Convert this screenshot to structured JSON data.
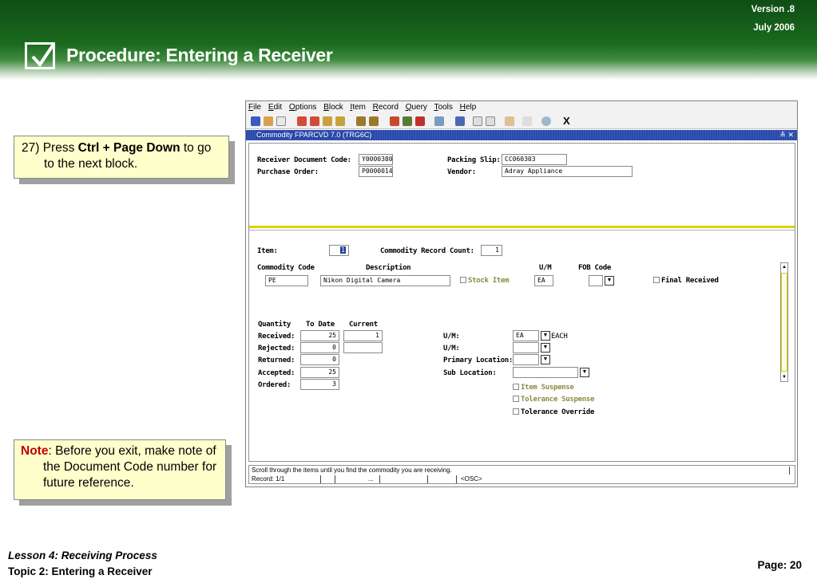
{
  "header": {
    "version": "Version .8",
    "date": "July  2006",
    "title": "Procedure: Entering a Receiver"
  },
  "callouts": {
    "step": {
      "number": "27)",
      "pre": " Press ",
      "keys": "Ctrl + Page Down",
      "post": " to go to the next block."
    },
    "note": {
      "label": "Note",
      "text": ": Before you exit, make note of the Document Code number for future reference."
    }
  },
  "footer": {
    "lesson": "Lesson 4: Receiving Process",
    "topic": "Topic 2: Entering a Receiver",
    "page": "Page: 20"
  },
  "app": {
    "menu": [
      "File",
      "Edit",
      "Options",
      "Block",
      "Item",
      "Record",
      "Query",
      "Tools",
      "Help"
    ],
    "window_title": "Commodity  FPARCVD  7.0  (TRG6C)",
    "window_controls": "≚ ✕",
    "toolbar_exit": "X",
    "key_block": {
      "receiver_doc_label": "Receiver Document Code:",
      "receiver_doc_value": "Y0000380",
      "po_label": "Purchase Order:",
      "po_value": "P0000014",
      "packing_slip_label": "Packing Slip:",
      "packing_slip_value": "CC060303",
      "vendor_label": "Vendor:",
      "vendor_value": "Adray Appliance"
    },
    "item": {
      "item_label": "Item:",
      "item_value": "1",
      "count_label": "Commodity Record Count:",
      "count_value": "1",
      "commodity_code_label": "Commodity Code",
      "description_label": "Description",
      "um_label": "U/M",
      "fob_label": "FOB Code",
      "commodity_code_value": "PE",
      "description_value": "Nikon Digital Camera",
      "stock_item_label": "Stock Item",
      "um_value": "EA",
      "fob_value": "",
      "final_received_label": "Final Received"
    },
    "quantity": {
      "quantity_label": "Quantity",
      "to_date_label": "To Date",
      "current_label": "Current",
      "rows": [
        {
          "label": "Received:",
          "to_date": "25",
          "current": "1"
        },
        {
          "label": "Rejected:",
          "to_date": "0",
          "current": ""
        },
        {
          "label": "Returned:",
          "to_date": "0"
        },
        {
          "label": "Accepted:",
          "to_date": "25"
        },
        {
          "label": "Ordered:",
          "to_date": "3"
        }
      ]
    },
    "right_fields": {
      "um1_label": "U/M:",
      "um1_value": "EA",
      "um1_desc": "EACH",
      "um2_label": "U/M:",
      "um2_value": "",
      "primary_location_label": "Primary Location:",
      "primary_location_value": "",
      "sub_location_label": "Sub Location:",
      "sub_location_value": "",
      "item_suspense_label": "Item  Suspense",
      "tolerance_suspense_label": "Tolerance Suspense",
      "tolerance_override_label": "Tolerance Override"
    },
    "status": {
      "message": "Scroll through the items until you find the commodity you are receiving.",
      "record": "Record: 1/1",
      "ellipsis": "...",
      "osc": "<OSC>"
    }
  },
  "colors": {
    "header_green": "#0f4d14",
    "callout_yellow": "#ffffcc",
    "note_red": "#c00000",
    "title_bar_blue": "#2a48a8",
    "separator_yellow": "#d8d200"
  }
}
